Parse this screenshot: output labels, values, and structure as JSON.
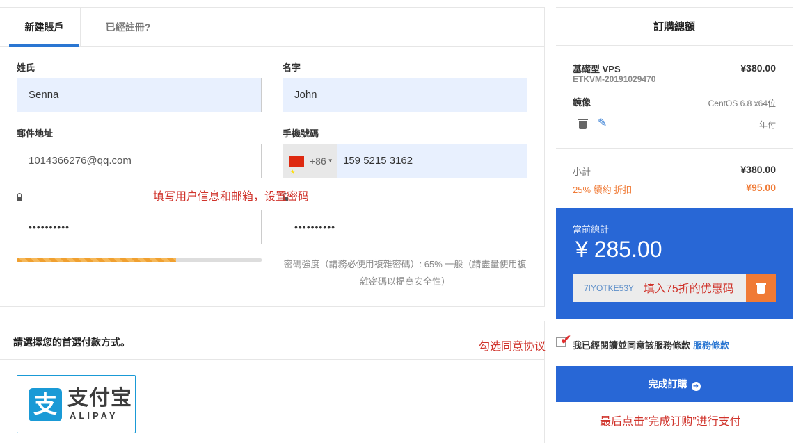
{
  "tabs": {
    "new_account": "新建賬戶",
    "registered": "已經註冊?"
  },
  "form": {
    "last_name_label": "姓氏",
    "last_name_value": "Senna",
    "first_name_label": "名字",
    "first_name_value": "John",
    "email_label": "郵件地址",
    "email_value": "1014366276@qq.com",
    "phone_label": "手機號碼",
    "phone_code": "+86",
    "phone_value": "159 5215 3162",
    "password_value": "••••••••••",
    "password_confirm_value": "••••••••••",
    "strength_fraction": 0.65,
    "strength_text": "密碼強度（請務必使用複雜密碼）: 65% 一般（請盡量使用複雜密碼以提高安全性）"
  },
  "annotations": {
    "fill_info": "填写用户信息和邮箱，设置密码",
    "promo": "填入75折的优惠码",
    "agree": "勾选同意协议",
    "final": "最后点击“完成订购”进行支付"
  },
  "payment": {
    "title": "請選擇您的首選付款方式。",
    "alipay_cn": "支付宝",
    "alipay_en": "ALIPAY",
    "alipay_glyph": "支"
  },
  "summary": {
    "title": "訂購總額",
    "product_name": "基礎型 VPS",
    "product_id": "ETKVM-20191029470",
    "product_price": "¥380.00",
    "image_label": "鏡像",
    "image_value": "CentOS 6.8 x64位",
    "billing": "年付",
    "subtotal_label": "小計",
    "subtotal_value": "¥380.00",
    "discount_label": "25% 續約 折扣",
    "discount_value": "¥95.00",
    "total_label": "當前總計",
    "total_value": "¥ 285.00",
    "promo_code": "7IYOTKE53Y",
    "tos_text": "我已經閱讀並同意該服務條款",
    "tos_link": "服務條款",
    "submit_label": "完成訂購"
  },
  "colors": {
    "accent": "#2867d6",
    "discount": "#f07a35",
    "annotation": "#d0342c"
  }
}
